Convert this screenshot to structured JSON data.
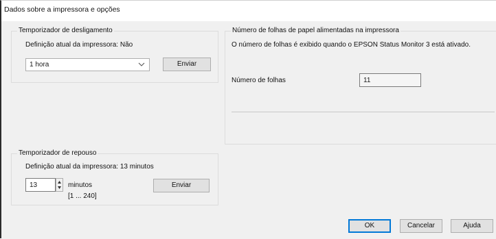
{
  "window": {
    "title": "Dados sobre a impressora e opções"
  },
  "power_off_timer": {
    "group_title": "Temporizador de desligamento",
    "current_setting": "Definição atual da impressora: Não",
    "selected_option": "1 hora",
    "send_label": "Enviar"
  },
  "paper_sheets": {
    "group_title": "Número de folhas de papel alimentadas na impressora",
    "info_text": "O número de folhas é exibido quando o EPSON Status Monitor 3 está ativado.",
    "count_label": "Número de folhas",
    "count_value": "11"
  },
  "sleep_timer": {
    "group_title": "Temporizador de repouso",
    "current_setting": "Definição atual da impressora: 13 minutos",
    "value": "13",
    "unit_label": "minutos",
    "range_label": "[1 ... 240]",
    "send_label": "Enviar"
  },
  "footer": {
    "ok_label": "OK",
    "cancel_label": "Cancelar",
    "help_label": "Ajuda"
  },
  "colors": {
    "dialog_background": "#f0f0f0",
    "default_button_border": "#0078d7"
  }
}
